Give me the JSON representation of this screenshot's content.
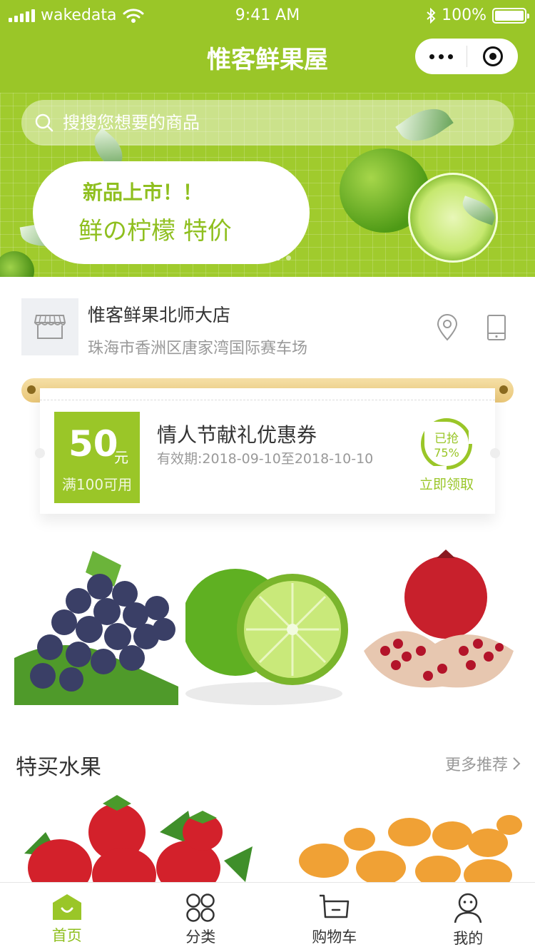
{
  "status_bar": {
    "carrier": "wakedata",
    "time": "9:41 AM",
    "battery": "100%"
  },
  "nav": {
    "title": "惟客鲜果屋"
  },
  "search": {
    "placeholder": "搜搜您想要的商品"
  },
  "banner": {
    "line1": "新品上市！！",
    "line2": "鲜の柠檬 特价",
    "page_count": 2,
    "active_page": 1
  },
  "store": {
    "name": "惟客鲜果北师大店",
    "address": "珠海市香洲区唐家湾国际赛车场"
  },
  "coupon": {
    "amount": "50",
    "unit": "元",
    "condition": "满100可用",
    "title": "情人节献礼优惠券",
    "validity": "有效期:2018-09-10至2018-10-10",
    "claimed_label": "已抢",
    "claimed_percent": "75%",
    "claim_button": "立即领取"
  },
  "fruit_cards": [
    {
      "icon": "grapes-image"
    },
    {
      "icon": "lime-image"
    },
    {
      "icon": "pomegranate-image"
    }
  ],
  "section": {
    "title": "特买水果",
    "more": "更多推荐"
  },
  "tabbar": {
    "items": [
      {
        "label": "首页",
        "icon": "home-icon",
        "active": true
      },
      {
        "label": "分类",
        "icon": "category-icon",
        "active": false
      },
      {
        "label": "购物车",
        "icon": "cart-icon",
        "active": false
      },
      {
        "label": "我的",
        "icon": "profile-icon",
        "active": false
      }
    ]
  },
  "colors": {
    "brand": "#9ac628",
    "text": "#333333",
    "muted": "#999999"
  }
}
